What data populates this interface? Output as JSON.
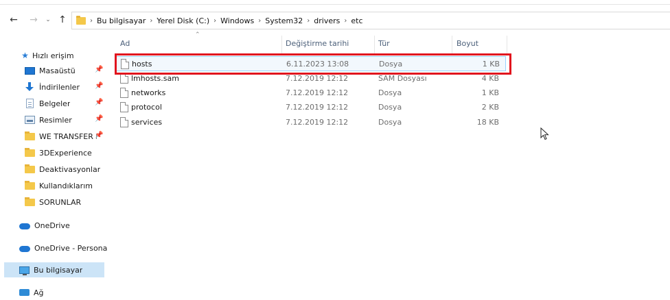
{
  "address_bar": {
    "crumbs": [
      "Bu bilgisayar",
      "Yerel Disk (C:)",
      "Windows",
      "System32",
      "drivers",
      "etc"
    ]
  },
  "columns": {
    "name": "Ad",
    "date": "Değiştirme tarihi",
    "type": "Tür",
    "size": "Boyut"
  },
  "files": [
    {
      "name": "hosts",
      "date": "6.11.2023 13:08",
      "type": "Dosya",
      "size": "1 KB"
    },
    {
      "name": "lmhosts.sam",
      "date": "7.12.2019 12:12",
      "type": "SAM Dosyası",
      "size": "4 KB"
    },
    {
      "name": "networks",
      "date": "7.12.2019 12:12",
      "type": "Dosya",
      "size": "1 KB"
    },
    {
      "name": "protocol",
      "date": "7.12.2019 12:12",
      "type": "Dosya",
      "size": "2 KB"
    },
    {
      "name": "services",
      "date": "7.12.2019 12:12",
      "type": "Dosya",
      "size": "18 KB"
    }
  ],
  "sidebar": {
    "quick_access": "Hızlı erişim",
    "items": [
      {
        "label": "Masaüstü",
        "icon": "desktop-icon"
      },
      {
        "label": "İndirilenler",
        "icon": "downloads-icon"
      },
      {
        "label": "Belgeler",
        "icon": "documents-icon"
      },
      {
        "label": "Resimler",
        "icon": "pictures-icon"
      },
      {
        "label": "WE TRANSFER KI",
        "icon": "folder-icon"
      },
      {
        "label": "3DExperience",
        "icon": "folder-icon"
      },
      {
        "label": "Deaktivasyonlar",
        "icon": "folder-icon"
      },
      {
        "label": "Kullandıklarım",
        "icon": "folder-icon"
      },
      {
        "label": "SORUNLAR",
        "icon": "folder-icon"
      }
    ],
    "onedrive": "OneDrive",
    "onedrive_personal": "OneDrive - Personal",
    "this_pc": "Bu bilgisayar",
    "network": "Ağ"
  },
  "colors": {
    "highlight_box": "#e1141e",
    "selected_bg": "#cce4f7"
  }
}
